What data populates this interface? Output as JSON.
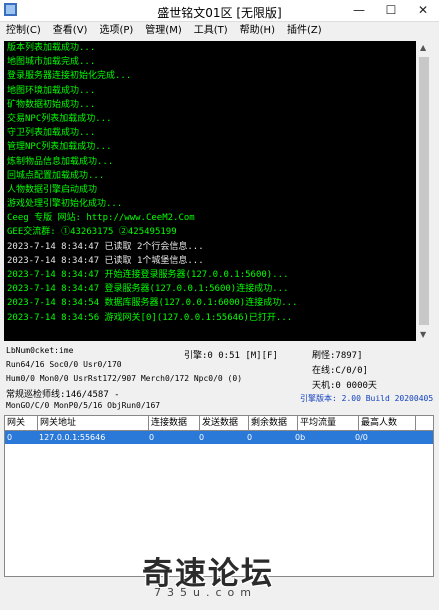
{
  "window": {
    "title": "盛世铭文01区 [无限版]",
    "minimize": "—",
    "maximize": "☐",
    "close": "✕"
  },
  "menu": [
    "控制(C)",
    "查看(V)",
    "选项(P)",
    "管理(M)",
    "工具(T)",
    "帮助(H)",
    "插件(Z)"
  ],
  "console_lines": [
    "版本列表加载成功...",
    "地图城市加载完成...",
    "登录服务器连接初始化完成...",
    "地图环境加载成功...",
    "矿物数据初始成功...",
    "交易NPC列表加载成功...",
    "守卫列表加载成功...",
    "管理NPC列表加载成功...",
    "炼制物品信息加载成功...",
    "回城点配置加载成功...",
    "人物数据引擎启动成功",
    "游戏处理引擎初始化成功...",
    "Ceeg 专版   网站: http://www.CeeM2.Com",
    "GEE交流群: ①43263175     ②425495199",
    "2023-7-14 8:34:47 已读取 2个行会信息...",
    "2023-7-14 8:34:47 已读取 1个城堡信息...",
    "2023-7-14 8:34:47 开始连接登录服务器(127.0.0.1:5600)...",
    "2023-7-14 8:34:47 登录服务器(127.0.0.1:5600)连接成功...",
    "2023-7-14 8:34:54 数据库服务器(127.0.0.1:6000)连接成功...",
    "2023-7-14 8:34:56 游戏网关[0](127.0.0.1:55646)已打开..."
  ],
  "status": {
    "line1_left": "LbNum0cket:ime",
    "line1_mid": "引擎:0 0:51 [M][F]",
    "line1_right": "刷怪:7897]",
    "line2_left": "Run64/16 Soc0/0 Usr0/170",
    "line2_right": "在线:C/0/0]",
    "line3_left": "Hum0/0 Mon0/0 UsrRst172/907 Merch0/172 Npc0/0 (0)",
    "line3_right": "天机:0 0000天",
    "line4_left": "常规巡检师线:146/4587 -",
    "line4_right": "引擎版本: 2.00 Build 20200405",
    "line5_left": "MonGO/C/0 MonP0/5/16 ObjRun0/167"
  },
  "table": {
    "headers": [
      "网关",
      "网关地址",
      "连接数据",
      "发送数据",
      "剩余数据",
      "平均流量",
      "最高人数"
    ],
    "rows": [
      [
        "0",
        "127.0.0.1:55646",
        "0",
        "0",
        "0",
        "0b",
        "0/0"
      ]
    ]
  },
  "watermark": {
    "main": "奇速论坛",
    "sub": "735u.com"
  }
}
